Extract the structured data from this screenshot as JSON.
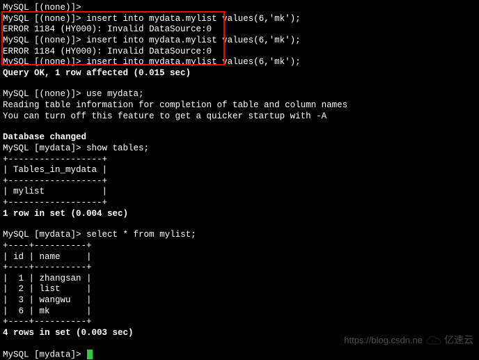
{
  "terminal": {
    "prompt_none": "MySQL [(none)]>",
    "prompt_mydata": "MySQL [mydata]>",
    "idle": "MySQL [(none)]>",
    "insert_stmt": "insert into mydata.mylist values(6,'mk');",
    "error_line": "ERROR 1184 (HY000): Invalid DataSource:0",
    "query_ok": "Query OK, 1 row affected (0.015 sec)",
    "use_stmt": "use mydata;",
    "reading_info": "Reading table information for completion of table and column names",
    "turn_off": "You can turn off this feature to get a quicker startup with -A",
    "db_changed": "Database changed",
    "show_tables_stmt": "show tables;",
    "tables_border": "+------------------+",
    "tables_header": "| Tables_in_mydata |",
    "tables_row": "| mylist           |",
    "rows_1": "1 row in set (0.004 sec)",
    "select_stmt": "select * from mylist;",
    "data_border": "+----+----------+",
    "data_header": "| id | name     |",
    "data_rows": [
      "|  1 | zhangsan |",
      "|  2 | list     |",
      "|  3 | wangwu   |",
      "|  6 | mk       |"
    ],
    "rows_4": "4 rows in set (0.003 sec)"
  },
  "watermark": {
    "url": "https://blog.csdn.ne",
    "brand": "亿速云"
  }
}
